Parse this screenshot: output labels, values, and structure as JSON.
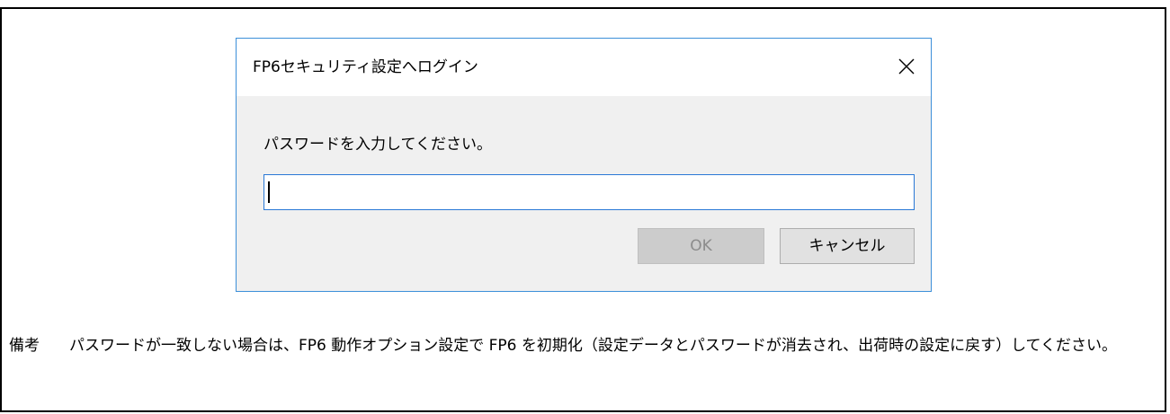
{
  "dialog": {
    "title": "FP6セキュリティ設定へログイン",
    "close_icon": "close-icon",
    "prompt": "パスワードを入力してください。",
    "password_value": "",
    "ok_label": "OK",
    "cancel_label": "キャンセル",
    "ok_enabled": false
  },
  "note": {
    "label": "備考",
    "text": "パスワードが一致しない場合は、FP6 動作オプション設定で FP6 を初期化（設定データとパスワードが消去され、出荷時の設定に戻す）してください。"
  },
  "colors": {
    "dialog_border": "#3c8fd9",
    "input_border": "#2a78d6",
    "dialog_body": "#f0f0f0",
    "disabled_button": "#cccccc"
  }
}
